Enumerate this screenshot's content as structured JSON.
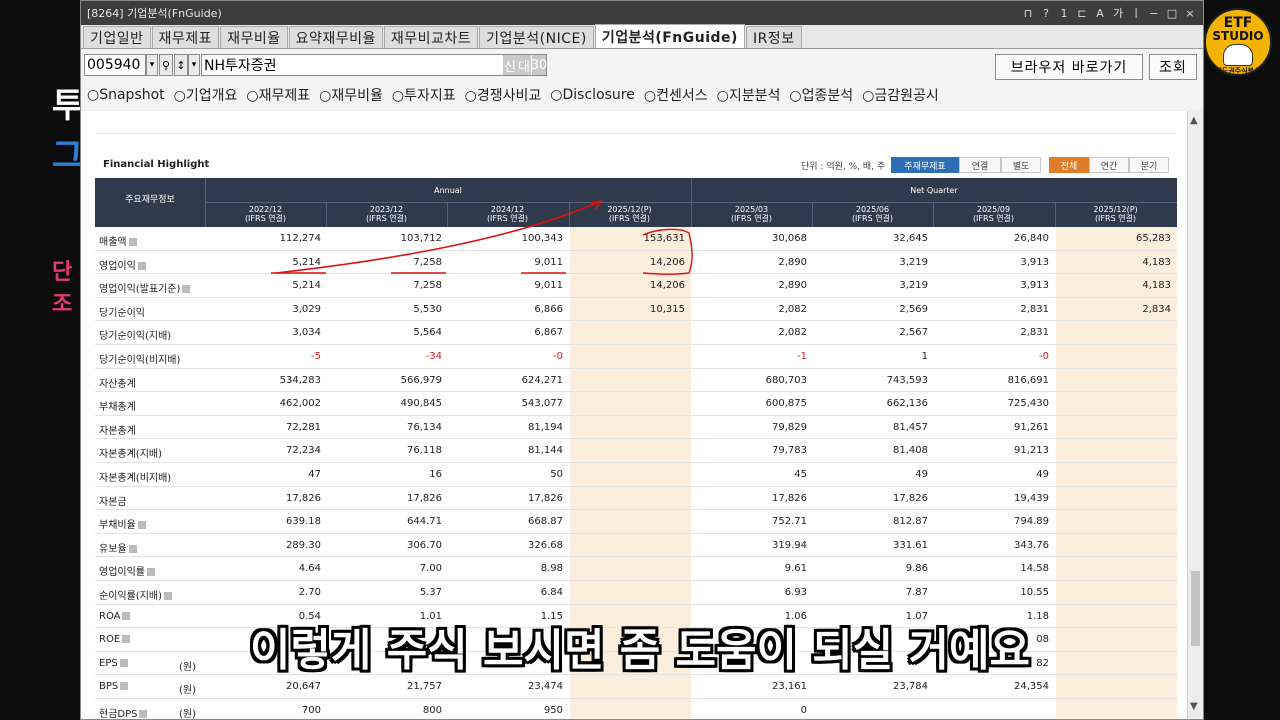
{
  "window": {
    "title": "[8264] 기업분석(FnGuide)",
    "title_icons": [
      "⊓",
      "?",
      "1",
      "⊏",
      "A",
      "가",
      "ㅣ",
      "−",
      "□",
      "×"
    ]
  },
  "tabs": [
    {
      "label": "기업일반",
      "active": false
    },
    {
      "label": "재무제표",
      "active": false
    },
    {
      "label": "재무비율",
      "active": false
    },
    {
      "label": "요약재무비율",
      "active": false
    },
    {
      "label": "재무비교차트",
      "active": false
    },
    {
      "label": "기업분석(NICE)",
      "active": false
    },
    {
      "label": "기업분석(FnGuide)",
      "active": true
    },
    {
      "label": "IR정보",
      "active": false
    }
  ],
  "search": {
    "code": "005940",
    "name": "NH투자증권",
    "tag1": "신",
    "tag2": "대",
    "tag3": "30",
    "browser_button": "브라우저 바로가기",
    "query_button": "조회"
  },
  "radios": [
    "Snapshot",
    "기업개요",
    "재무제표",
    "재무비율",
    "투자지표",
    "경쟁사비교",
    "Disclosure",
    "컨센서스",
    "지분분석",
    "업종분석",
    "금감원공시"
  ],
  "highlight": {
    "title": "Financial Highlight",
    "unit": "단위 : 억원, %, 배, 주",
    "btn_main": "주재무제표",
    "btn_consol": "연결",
    "btn_sep": "별도",
    "btn_all": "전체",
    "btn_year": "연간",
    "btn_qtr": "분기"
  },
  "table": {
    "corner": "주요재무정보",
    "annual": "Annual",
    "net_quarter": "Net Quarter",
    "columns": [
      {
        "p": "2022/12",
        "s": "(IFRS 연결)"
      },
      {
        "p": "2023/12",
        "s": "(IFRS 연결)"
      },
      {
        "p": "2024/12",
        "s": "(IFRS 연결)"
      },
      {
        "p": "2025/12(P)",
        "s": "(IFRS 연결)"
      },
      {
        "p": "2025/03",
        "s": "(IFRS 연결)"
      },
      {
        "p": "2025/06",
        "s": "(IFRS 연결)"
      },
      {
        "p": "2025/09",
        "s": "(IFRS 연결)"
      },
      {
        "p": "2025/12(P)",
        "s": "(IFRS 연결)"
      }
    ],
    "rows": [
      {
        "label": "매출액",
        "info": true,
        "unit": "",
        "v": [
          "112,274",
          "103,712",
          "100,343",
          "153,631",
          "30,068",
          "32,645",
          "26,840",
          "65,283"
        ]
      },
      {
        "label": "영업이익",
        "info": true,
        "unit": "",
        "v": [
          "5,214",
          "7,258",
          "9,011",
          "14,206",
          "2,890",
          "3,219",
          "3,913",
          "4,183"
        ]
      },
      {
        "label": "영업이익(발표기준)",
        "info": true,
        "unit": "",
        "v": [
          "5,214",
          "7,258",
          "9,011",
          "14,206",
          "2,890",
          "3,219",
          "3,913",
          "4,183"
        ]
      },
      {
        "label": "당기순이익",
        "info": false,
        "unit": "",
        "v": [
          "3,029",
          "5,530",
          "6,866",
          "10,315",
          "2,082",
          "2,569",
          "2,831",
          "2,834"
        ]
      },
      {
        "label": " 당기순이익(지배)",
        "info": false,
        "unit": "",
        "v": [
          "3,034",
          "5,564",
          "6,867",
          "",
          "2,082",
          "2,567",
          "2,831",
          ""
        ]
      },
      {
        "label": " 당기순이익(비지배)",
        "info": false,
        "unit": "",
        "v": [
          "-5",
          "-34",
          "-0",
          "",
          "-1",
          "1",
          "-0",
          ""
        ]
      },
      {
        "label": "자산총계",
        "info": false,
        "unit": "",
        "v": [
          "534,283",
          "566,979",
          "624,271",
          "",
          "680,703",
          "743,593",
          "816,691",
          ""
        ]
      },
      {
        "label": "부채총계",
        "info": false,
        "unit": "",
        "v": [
          "462,002",
          "490,845",
          "543,077",
          "",
          "600,875",
          "662,136",
          "725,430",
          ""
        ]
      },
      {
        "label": "자본총계",
        "info": false,
        "unit": "",
        "v": [
          "72,281",
          "76,134",
          "81,194",
          "",
          "79,829",
          "81,457",
          "91,261",
          ""
        ]
      },
      {
        "label": " 자본총계(지배)",
        "info": false,
        "unit": "",
        "v": [
          "72,234",
          "76,118",
          "81,144",
          "",
          "79,783",
          "81,408",
          "91,213",
          ""
        ]
      },
      {
        "label": " 자본총계(비지배)",
        "info": false,
        "unit": "",
        "v": [
          "47",
          "16",
          "50",
          "",
          "45",
          "49",
          "49",
          ""
        ]
      },
      {
        "label": "자본금",
        "info": false,
        "unit": "",
        "v": [
          "17,826",
          "17,826",
          "17,826",
          "",
          "17,826",
          "17,826",
          "19,439",
          ""
        ]
      },
      {
        "label": "부채비율",
        "info": true,
        "unit": "",
        "v": [
          "639.18",
          "644.71",
          "668.87",
          "",
          "752.71",
          "812.87",
          "794.89",
          ""
        ]
      },
      {
        "label": "유보율",
        "info": true,
        "unit": "",
        "v": [
          "289.30",
          "306.70",
          "326.68",
          "",
          "319.94",
          "331.61",
          "343.76",
          ""
        ]
      },
      {
        "label": "영업이익률",
        "info": true,
        "unit": "",
        "v": [
          "4.64",
          "7.00",
          "8.98",
          "",
          "9.61",
          "9.86",
          "14.58",
          ""
        ]
      },
      {
        "label": "순이익률(지배)",
        "info": true,
        "unit": "",
        "v": [
          "2.70",
          "5.37",
          "6.84",
          "",
          "6.93",
          "7.87",
          "10.55",
          ""
        ]
      },
      {
        "label": "ROA",
        "info": true,
        "unit": "",
        "v": [
          "0.54",
          "1.01",
          "1.15",
          "",
          "1.06",
          "1.07",
          "1.18",
          ""
        ]
      },
      {
        "label": "ROE",
        "info": true,
        "unit": "",
        "v": [
          "",
          "",
          "",
          "",
          "",
          "",
          "08",
          ""
        ]
      },
      {
        "label": "EPS",
        "info": true,
        "unit": "(원)",
        "v": [
          "",
          "",
          "",
          "",
          "",
          "",
          "82",
          ""
        ]
      },
      {
        "label": "BPS",
        "info": true,
        "unit": "(원)",
        "v": [
          "20,647",
          "21,757",
          "23,474",
          "",
          "23,161",
          "23,784",
          "24,354",
          ""
        ]
      },
      {
        "label": "현금DPS",
        "info": true,
        "unit": "(원)",
        "v": [
          "700",
          "800",
          "950",
          "",
          "0",
          "",
          "",
          ""
        ]
      }
    ]
  },
  "subtitle": "이렇게 주식 보시면 좀 도움이 되실 거예요",
  "logo": {
    "line1": "ETF",
    "line2": "STUDIO",
    "line3": "제도권주식분석"
  },
  "bg_left_chars": [
    "투",
    "그",
    "단",
    "조"
  ],
  "colors": {
    "header": "#2f3a4d",
    "accent_blue": "#2c6fb6",
    "accent_orange": "#e07d2a",
    "annotation_red": "#e01010",
    "logo_yellow": "#f5b400"
  }
}
